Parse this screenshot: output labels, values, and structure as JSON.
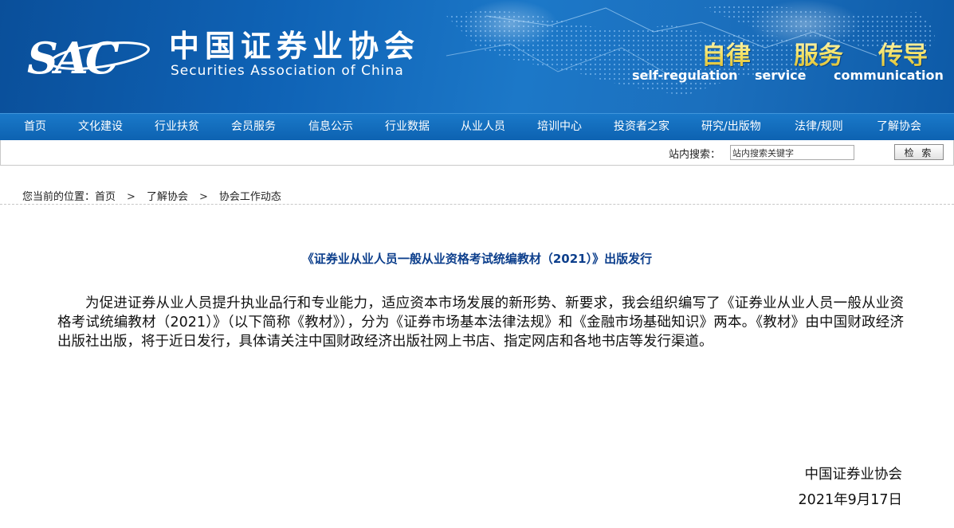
{
  "header": {
    "logo_text": "SAC",
    "org_name_cn": "中国证券业协会",
    "org_name_en": "Securities Association of China",
    "slogans": [
      {
        "cn": "自律",
        "en": "self-regulation"
      },
      {
        "cn": "服务",
        "en": "service"
      },
      {
        "cn": "传导",
        "en": "communication"
      }
    ]
  },
  "nav": {
    "items": [
      "首页",
      "文化建设",
      "行业扶贫",
      "会员服务",
      "信息公示",
      "行业数据",
      "从业人员",
      "培训中心",
      "投资者之家",
      "研究/出版物",
      "法律/规则",
      "了解协会"
    ]
  },
  "search": {
    "label": "站内搜索：",
    "placeholder": "站内搜索关键字",
    "button_label": "检 索"
  },
  "breadcrumb": {
    "prefix": "您当前的位置：",
    "items": [
      "首页",
      "了解协会",
      "协会工作动态"
    ],
    "separator": ">"
  },
  "article": {
    "title": "《证券业从业人员一般从业资格考试统编教材（2021）》出版发行",
    "body": "为促进证券从业人员提升执业品行和专业能力，适应资本市场发展的新形势、新要求，我会组织编写了《证券业从业人员一般从业资格考试统编教材（2021）》（以下简称《教材》），分为《证券市场基本法律法规》和《金融市场基础知识》两本。《教材》由中国财政经济出版社出版，将于近日发行，具体请关注中国财政经济出版社网上书店、指定网店和各地书店等发行渠道。",
    "signature_org": "中国证券业协会",
    "signature_date": "2021年9月17日"
  },
  "colors": {
    "banner_blue": "#0f63b6",
    "nav_blue": "#0d62b1",
    "title_blue": "#0d3f8c",
    "slogan_gold": "#f3e163"
  }
}
